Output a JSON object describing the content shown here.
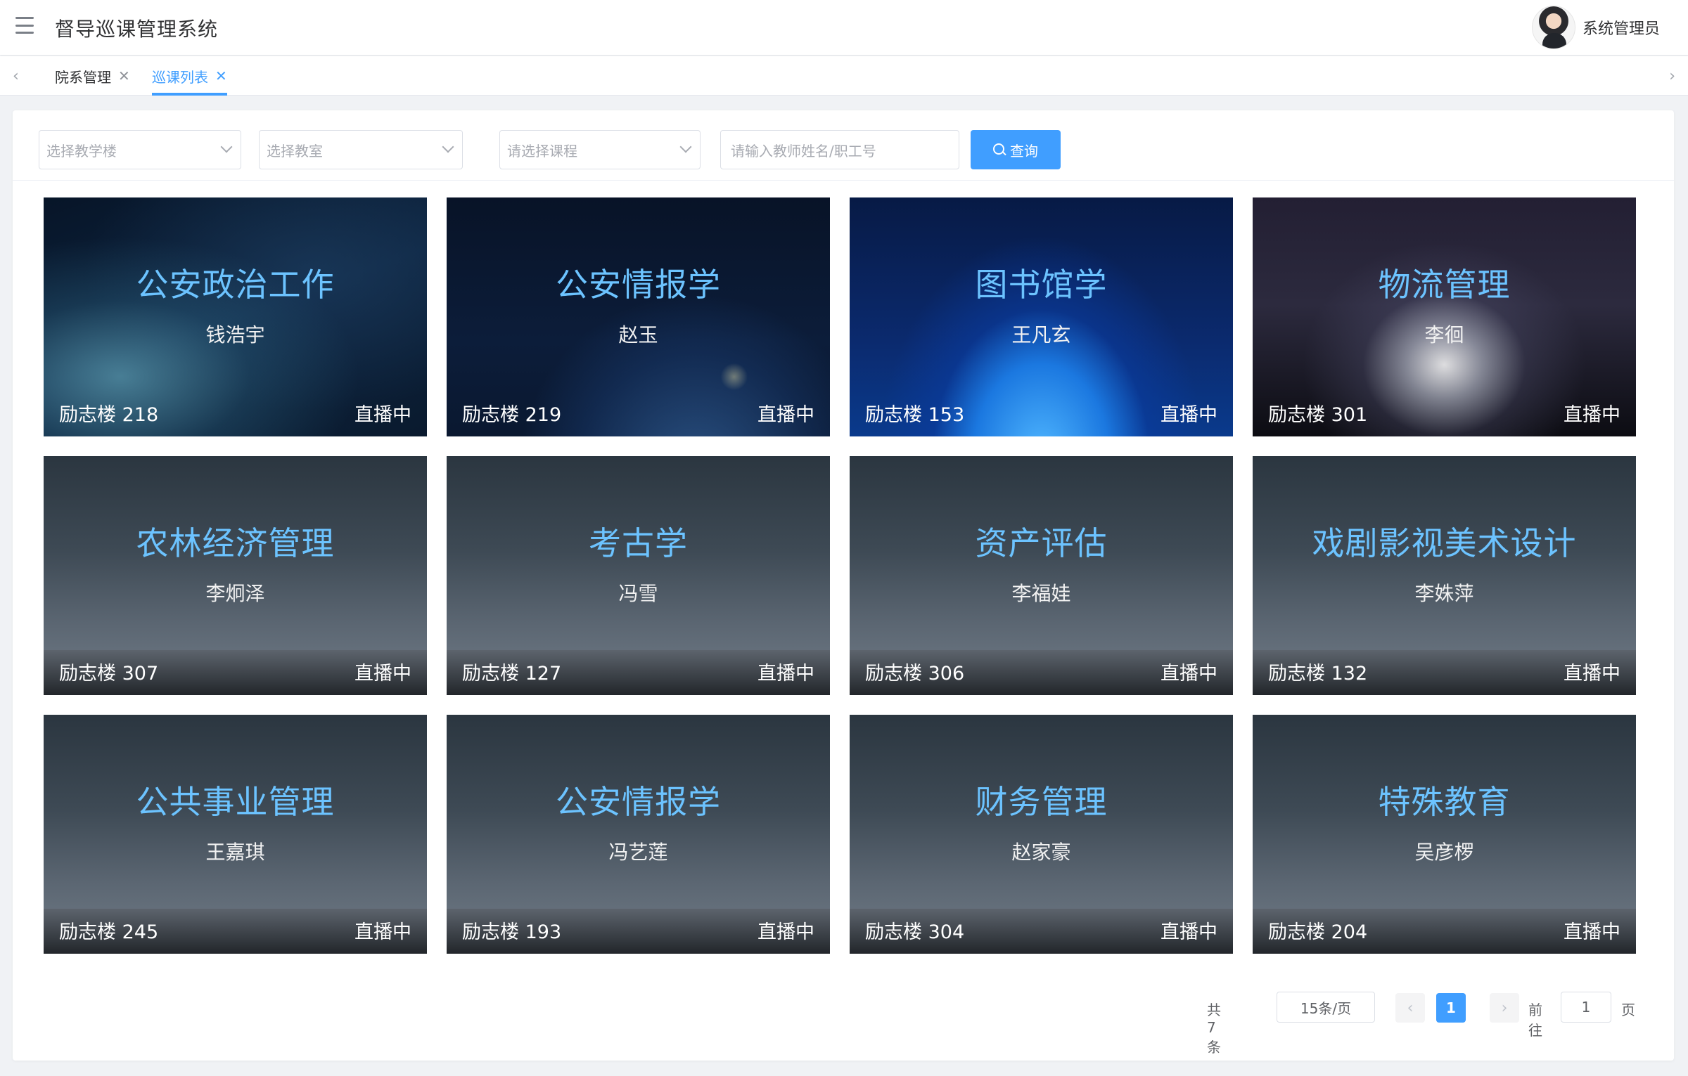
{
  "header": {
    "title": "督导巡课管理系统",
    "user_name": "系统管理员"
  },
  "tabs": [
    {
      "label": "院系管理"
    },
    {
      "label": "巡课列表"
    }
  ],
  "filters": {
    "building_placeholder": "选择教学楼",
    "classroom_placeholder": "选择教室",
    "course_placeholder": "请选择课程",
    "teacher_placeholder": "请输入教师姓名/职工号",
    "query_label": "查询"
  },
  "cards": [
    {
      "course": "公安政治工作",
      "teacher": "钱浩宇",
      "building": "励志楼",
      "room": "218",
      "status": "直播中"
    },
    {
      "course": "公安情报学",
      "teacher": "赵玉",
      "building": "励志楼",
      "room": "219",
      "status": "直播中"
    },
    {
      "course": "图书馆学",
      "teacher": "王凡玄",
      "building": "励志楼",
      "room": "153",
      "status": "直播中"
    },
    {
      "course": "物流管理",
      "teacher": "李徊",
      "building": "励志楼",
      "room": "301",
      "status": "直播中"
    },
    {
      "course": "农林经济管理",
      "teacher": "李炯泽",
      "building": "励志楼",
      "room": "307",
      "status": "直播中"
    },
    {
      "course": "考古学",
      "teacher": "冯雪",
      "building": "励志楼",
      "room": "127",
      "status": "直播中"
    },
    {
      "course": "资产评估",
      "teacher": "李福娃",
      "building": "励志楼",
      "room": "306",
      "status": "直播中"
    },
    {
      "course": "戏剧影视美术设计",
      "teacher": "李姝萍",
      "building": "励志楼",
      "room": "132",
      "status": "直播中"
    },
    {
      "course": "公共事业管理",
      "teacher": "王嘉琪",
      "building": "励志楼",
      "room": "245",
      "status": "直播中"
    },
    {
      "course": "公安情报学",
      "teacher": "冯艺莲",
      "building": "励志楼",
      "room": "193",
      "status": "直播中"
    },
    {
      "course": "财务管理",
      "teacher": "赵家豪",
      "building": "励志楼",
      "room": "304",
      "status": "直播中"
    },
    {
      "course": "特殊教育",
      "teacher": "吴彦椤",
      "building": "励志楼",
      "room": "204",
      "status": "直播中"
    }
  ],
  "pagination": {
    "total_text": "共 7 条",
    "page_size": "15条/页",
    "current_page": "1",
    "goto_label": "前往",
    "goto_value": "1",
    "page_suffix": "页"
  }
}
